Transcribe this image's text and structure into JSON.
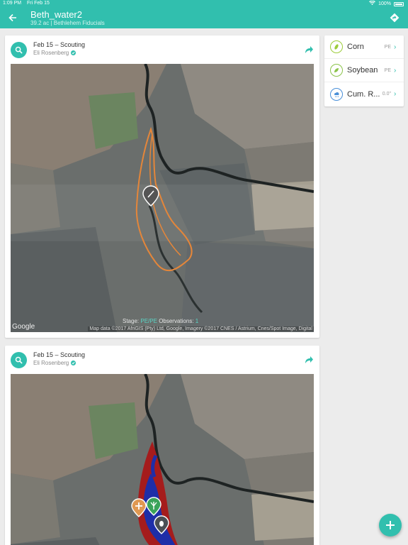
{
  "status_bar": {
    "time": "1:09 PM",
    "date": "Fri Feb 15",
    "battery": "100%"
  },
  "header": {
    "title": "Beth_water2",
    "subtitle": "39.2 ac | Bethlehem Fiducials"
  },
  "cards": [
    {
      "title": "Feb 15 – Scouting",
      "author": "Eli Rosenberg",
      "stage_label": "Stage:",
      "stage_value": "PE/PE",
      "observations_label": "Observations:",
      "observations_value": "1",
      "google": "Google",
      "credit": "Map data ©2017 AfriGIS (Pty) Ltd, Google, Imagery ©2017 CNES / Astrium, Cnes/Spot Image, Digital"
    },
    {
      "title": "Feb 15 – Scouting",
      "author": "Eli Rosenberg"
    }
  ],
  "crops": [
    {
      "name": "Corn",
      "stage": "PE",
      "icon": "corn-icon",
      "color": "#9ccc3a"
    },
    {
      "name": "Soybean",
      "stage": "PE",
      "icon": "soybean-icon",
      "color": "#8bc34a"
    },
    {
      "name": "Cum. R...",
      "stage": "0.0\"",
      "icon": "rain-cloud-icon",
      "color": "#4a90d9"
    }
  ],
  "colors": {
    "accent": "#31bfae",
    "boundary": "#e4863a",
    "zone_red": "#a51c1c",
    "zone_blue": "#1e2ea8"
  }
}
